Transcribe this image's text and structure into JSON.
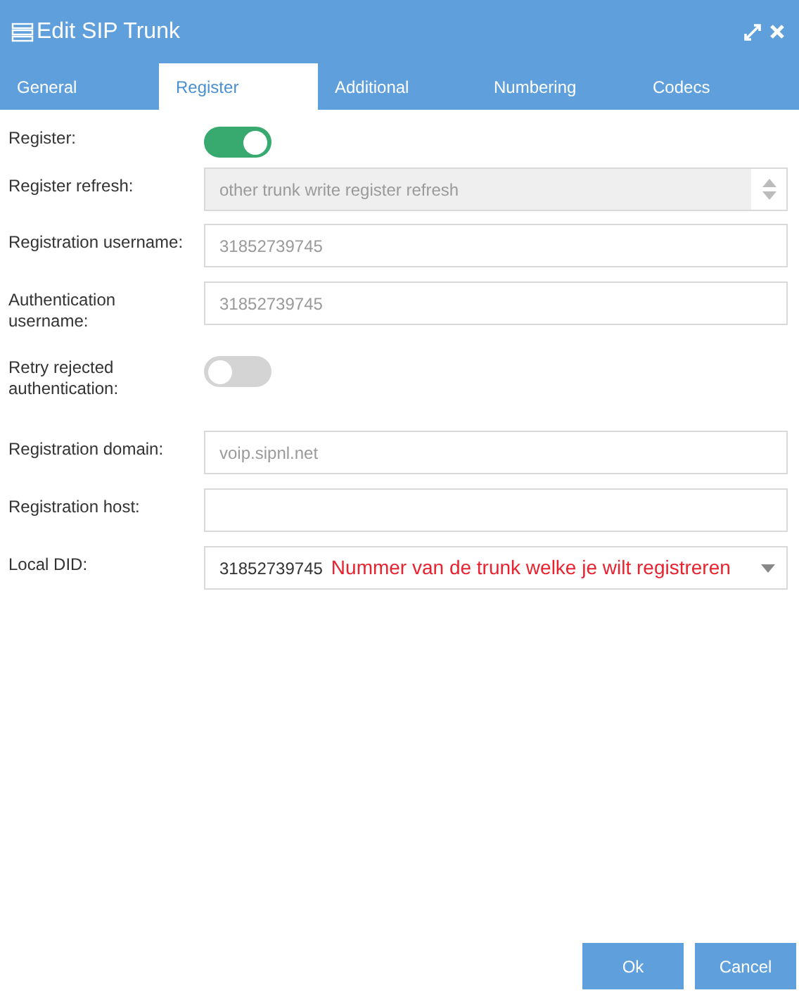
{
  "window": {
    "title": "Edit SIP Trunk"
  },
  "tabs": [
    {
      "label": "General",
      "selected": false
    },
    {
      "label": "Register",
      "selected": true
    },
    {
      "label": "Additional",
      "selected": false
    },
    {
      "label": "Numbering",
      "selected": false
    },
    {
      "label": "Codecs",
      "selected": false
    }
  ],
  "fields": [
    {
      "kind": "toggle",
      "label": "Register:",
      "on": true
    },
    {
      "kind": "spinner",
      "label": "Register refresh:",
      "placeholder": "other trunk write register refresh",
      "disabled": true
    },
    {
      "kind": "text",
      "label": "Registration username:",
      "placeholder": "31852739745",
      "disabled": false
    },
    {
      "kind": "text",
      "label": "Authentication username:",
      "placeholder": "31852739745",
      "disabled": false
    },
    {
      "kind": "toggle",
      "label": "Retry rejected authentication:",
      "on": false
    },
    {
      "kind": "text",
      "label": "Registration domain:",
      "placeholder": "voip.sipnl.net",
      "disabled": false
    },
    {
      "kind": "text",
      "label": "Registration host:",
      "disabled": false
    },
    {
      "kind": "select",
      "label": "Local DID:",
      "value": "31852739745",
      "note": "Nummer van de trunk welke je wilt registreren"
    }
  ],
  "buttons": [
    "Ok",
    "Cancel"
  ]
}
